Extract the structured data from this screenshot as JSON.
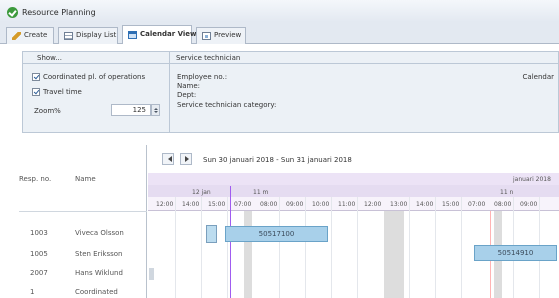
{
  "app": {
    "title": "Resource Planning"
  },
  "tabs": [
    {
      "label": "Create",
      "icon": "pencil-icon"
    },
    {
      "label": "Display List",
      "icon": "list-icon"
    },
    {
      "label": "Calendar View",
      "icon": "calendar-icon"
    },
    {
      "label": "Preview",
      "icon": "preview-icon"
    }
  ],
  "show": {
    "header": "Show...",
    "coordinated_label": "Coordinated pl. of operations",
    "travel_time_label": "Travel time",
    "zoom_label": "Zoom%",
    "zoom_value": "125"
  },
  "tech": {
    "header": "Service technician",
    "employee_no": "Employee no.:",
    "name": "Name:",
    "dept": "Dept:",
    "category": "Service technician category:",
    "right_label": "Calendar"
  },
  "grid": {
    "col_resp": "Resp. no.",
    "col_name": "Name",
    "rows": [
      {
        "no": "1003",
        "name": "Viveca Olsson"
      },
      {
        "no": "1005",
        "name": "Sten Eriksson"
      },
      {
        "no": "2007",
        "name": "Hans Wiklund"
      },
      {
        "no": "1",
        "name": "Coordinated"
      }
    ]
  },
  "calendar": {
    "date_range": "Sun 30 januari 2018 - Sun 31 januari 2018",
    "top_right_day": "januari 2018",
    "day_labels": [
      "12 jan",
      "11 m",
      "11 n"
    ],
    "hours": [
      "12:00",
      "14:00",
      "15:00",
      "07:00",
      "08:00",
      "09:00",
      "10:00",
      "11:00",
      "12:00",
      "13:00",
      "14:00",
      "15:00",
      "07:00",
      "08:00",
      "09:00"
    ],
    "events": [
      {
        "label": "50517100"
      },
      {
        "label": "50514910"
      }
    ]
  }
}
